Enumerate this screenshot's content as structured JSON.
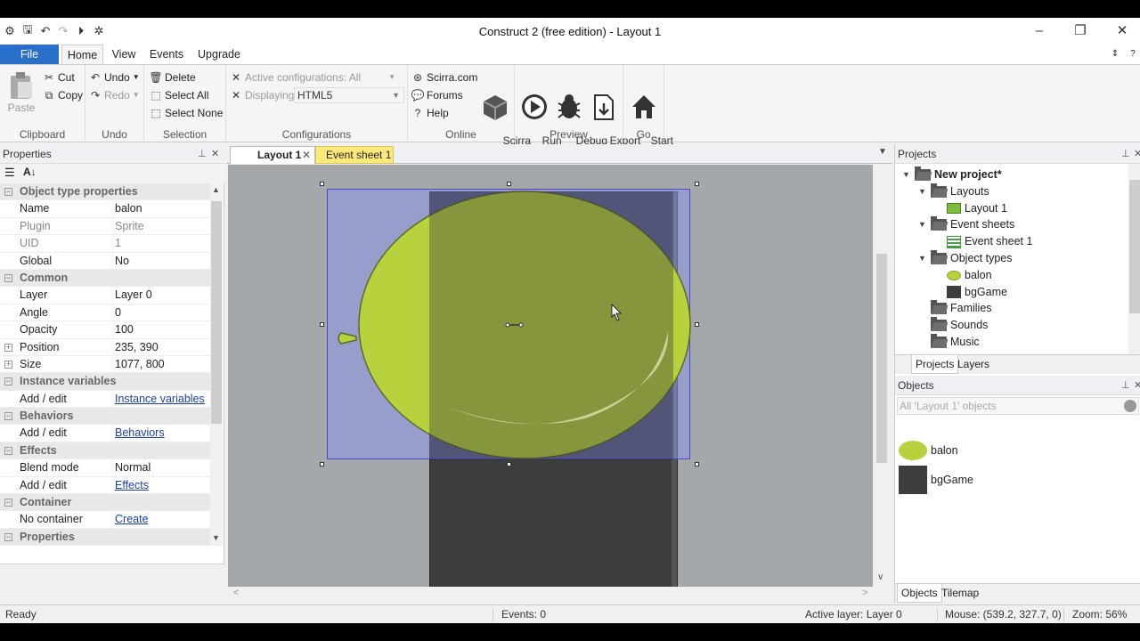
{
  "window": {
    "title": "Construct 2  (free edition) - Layout 1"
  },
  "ribbon_tabs": [
    "File",
    "Home",
    "View",
    "Events",
    "Upgrade"
  ],
  "clipboard": {
    "paste": "Paste",
    "cut": "Cut",
    "copy": "Copy",
    "label": "Clipboard"
  },
  "undo": {
    "undo": "Undo",
    "redo": "Redo",
    "label": "Undo"
  },
  "selection": {
    "delete": "Delete",
    "select_all": "Select All",
    "select_none": "Select None",
    "label": "Selection"
  },
  "configurations": {
    "active": "Active configurations: All",
    "displaying_label": "Displaying:",
    "displaying_value": "HTML5",
    "label": "Configurations"
  },
  "online": {
    "scirra": "Scirra.com",
    "forums": "Forums",
    "help": "Help",
    "store": "Scirra\nStore",
    "label": "Online"
  },
  "preview": {
    "run": "Run\nlayout",
    "debug": "Debug\nlayout",
    "export": "Export\nproject",
    "label": "Preview"
  },
  "go": {
    "start": "Start\nPage",
    "label": "Go"
  },
  "properties": {
    "title": "Properties",
    "rows": [
      {
        "type": "cat",
        "name": "Object type properties"
      },
      {
        "name": "Name",
        "value": "balon"
      },
      {
        "name": "Plugin",
        "value": "Sprite",
        "readonly": true
      },
      {
        "name": "UID",
        "value": "1",
        "readonly": true
      },
      {
        "name": "Global",
        "value": "No"
      },
      {
        "type": "cat",
        "name": "Common"
      },
      {
        "name": "Layer",
        "value": "Layer 0"
      },
      {
        "name": "Angle",
        "value": "0"
      },
      {
        "name": "Opacity",
        "value": "100"
      },
      {
        "name": "Position",
        "value": "235, 390",
        "expand": true
      },
      {
        "name": "Size",
        "value": "1077, 800",
        "expand": true
      },
      {
        "type": "cat",
        "name": "Instance variables"
      },
      {
        "name": "Add / edit",
        "value": "Instance variables",
        "link": true
      },
      {
        "type": "cat",
        "name": "Behaviors"
      },
      {
        "name": "Add / edit",
        "value": "Behaviors",
        "link": true
      },
      {
        "type": "cat",
        "name": "Effects"
      },
      {
        "name": "Blend mode",
        "value": "Normal"
      },
      {
        "name": "Add / edit",
        "value": "Effects",
        "link": true
      },
      {
        "type": "cat",
        "name": "Container"
      },
      {
        "name": "No container",
        "value": "Create",
        "link": true
      },
      {
        "type": "cat",
        "name": "Properties"
      }
    ]
  },
  "doc_tabs": {
    "layout": "Layout 1",
    "events": "Event sheet 1"
  },
  "projects": {
    "title": "Projects",
    "tree": [
      {
        "label": "New project*",
        "level": 0,
        "icon": "folder-icon",
        "bold": true
      },
      {
        "label": "Layouts",
        "level": 1,
        "icon": "folder-icon"
      },
      {
        "label": "Layout 1",
        "level": 2,
        "icon": "layout-icon"
      },
      {
        "label": "Event sheets",
        "level": 1,
        "icon": "folder-icon"
      },
      {
        "label": "Event sheet 1",
        "level": 2,
        "icon": "event-sheet-icon"
      },
      {
        "label": "Object types",
        "level": 1,
        "icon": "folder-icon"
      },
      {
        "label": "balon",
        "level": 2,
        "icon": "balloon-icon"
      },
      {
        "label": "bgGame",
        "level": 2,
        "icon": "bg-icon"
      },
      {
        "label": "Families",
        "level": 1,
        "icon": "folder-icon"
      },
      {
        "label": "Sounds",
        "level": 1,
        "icon": "folder-icon"
      },
      {
        "label": "Music",
        "level": 1,
        "icon": "folder-icon"
      }
    ],
    "tabs": [
      "Projects",
      "Layers"
    ]
  },
  "objects": {
    "title": "Objects",
    "filter": "All 'Layout 1' objects",
    "items": [
      "balon",
      "bgGame"
    ],
    "tabs": [
      "Objects",
      "Tilemap"
    ]
  },
  "status": {
    "ready": "Ready",
    "events": "Events: 0",
    "layer": "Active layer: Layer 0",
    "mouse": "Mouse: (539.2, 327.7, 0)",
    "zoom": "Zoom: 56%"
  },
  "colors": {
    "accent": "#2a6fc9",
    "balloon": "#b8d23e",
    "selection": "#8c96e6",
    "bg_object": "#3d3d3d"
  }
}
